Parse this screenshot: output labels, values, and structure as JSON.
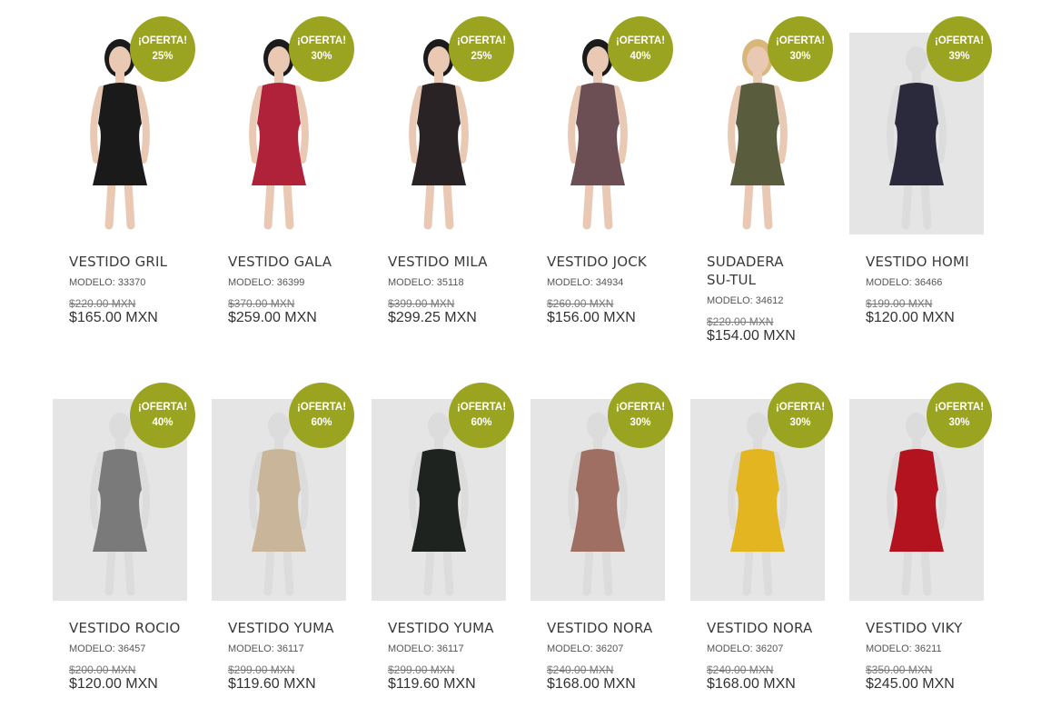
{
  "colors": {
    "badge": "#9aa421",
    "image_bg_grey": "#e5e5e5"
  },
  "products": [
    {
      "name": "VESTIDO GRIL",
      "model": "MODELO: 33370",
      "old_price": "$220.00 MXN",
      "price": "$165.00 MXN",
      "badge_title": "¡OFERTA!",
      "badge_pct": "25%",
      "bg": "white",
      "dress": "#1a1a1a",
      "style": "model"
    },
    {
      "name": "VESTIDO GALA",
      "model": "MODELO: 36399",
      "old_price": "$370.00 MXN",
      "price": "$259.00 MXN",
      "badge_title": "¡OFERTA!",
      "badge_pct": "30%",
      "bg": "white",
      "dress": "#b0213a",
      "style": "model"
    },
    {
      "name": "VESTIDO MILA",
      "model": "MODELO: 35118",
      "old_price": "$399.00 MXN",
      "price": "$299.25 MXN",
      "badge_title": "¡OFERTA!",
      "badge_pct": "25%",
      "bg": "white",
      "dress": "#2a2326",
      "style": "model"
    },
    {
      "name": "VESTIDO JOCK",
      "model": "MODELO: 34934",
      "old_price": "$260.00 MXN",
      "price": "$156.00 MXN",
      "badge_title": "¡OFERTA!",
      "badge_pct": "40%",
      "bg": "white",
      "dress": "#6b4f55",
      "style": "model"
    },
    {
      "name": "SUDADERA SU-TUL",
      "model": "MODELO: 34612",
      "old_price": "$220.00 MXN",
      "price": "$154.00 MXN",
      "badge_title": "¡OFERTA!",
      "badge_pct": "30%",
      "bg": "white",
      "dress": "#5a5c3e",
      "style": "model"
    },
    {
      "name": "VESTIDO HOMI",
      "model": "MODELO: 36466",
      "old_price": "$199.00 MXN",
      "price": "$120.00 MXN",
      "badge_title": "¡OFERTA!",
      "badge_pct": "39%",
      "bg": "grey",
      "dress": "#2b2a3d",
      "style": "mannequin"
    },
    {
      "name": "VESTIDO ROCIO",
      "model": "MODELO: 36457",
      "old_price": "$200.00 MXN",
      "price": "$120.00 MXN",
      "badge_title": "¡OFERTA!",
      "badge_pct": "40%",
      "bg": "grey",
      "dress": "#7a7a7a",
      "style": "mannequin"
    },
    {
      "name": "VESTIDO YUMA",
      "model": "MODELO: 36117",
      "old_price": "$299.00 MXN",
      "price": "$119.60 MXN",
      "badge_title": "¡OFERTA!",
      "badge_pct": "60%",
      "bg": "grey",
      "dress": "#c9b69a",
      "style": "mannequin"
    },
    {
      "name": "VESTIDO YUMA",
      "model": "MODELO: 36117",
      "old_price": "$299.00 MXN",
      "price": "$119.60 MXN",
      "badge_title": "¡OFERTA!",
      "badge_pct": "60%",
      "bg": "grey",
      "dress": "#1e2320",
      "style": "mannequin"
    },
    {
      "name": "VESTIDO NORA",
      "model": "MODELO: 36207",
      "old_price": "$240.00 MXN",
      "price": "$168.00 MXN",
      "badge_title": "¡OFERTA!",
      "badge_pct": "30%",
      "bg": "grey",
      "dress": "#9e6f62",
      "style": "mannequin"
    },
    {
      "name": "VESTIDO NORA",
      "model": "MODELO: 36207",
      "old_price": "$240.00 MXN",
      "price": "$168.00 MXN",
      "badge_title": "¡OFERTA!",
      "badge_pct": "30%",
      "bg": "grey",
      "dress": "#e2b521",
      "style": "mannequin"
    },
    {
      "name": "VESTIDO VIKY",
      "model": "MODELO: 36211",
      "old_price": "$350.00 MXN",
      "price": "$245.00 MXN",
      "badge_title": "¡OFERTA!",
      "badge_pct": "30%",
      "bg": "grey",
      "dress": "#b3121f",
      "style": "mannequin"
    }
  ]
}
